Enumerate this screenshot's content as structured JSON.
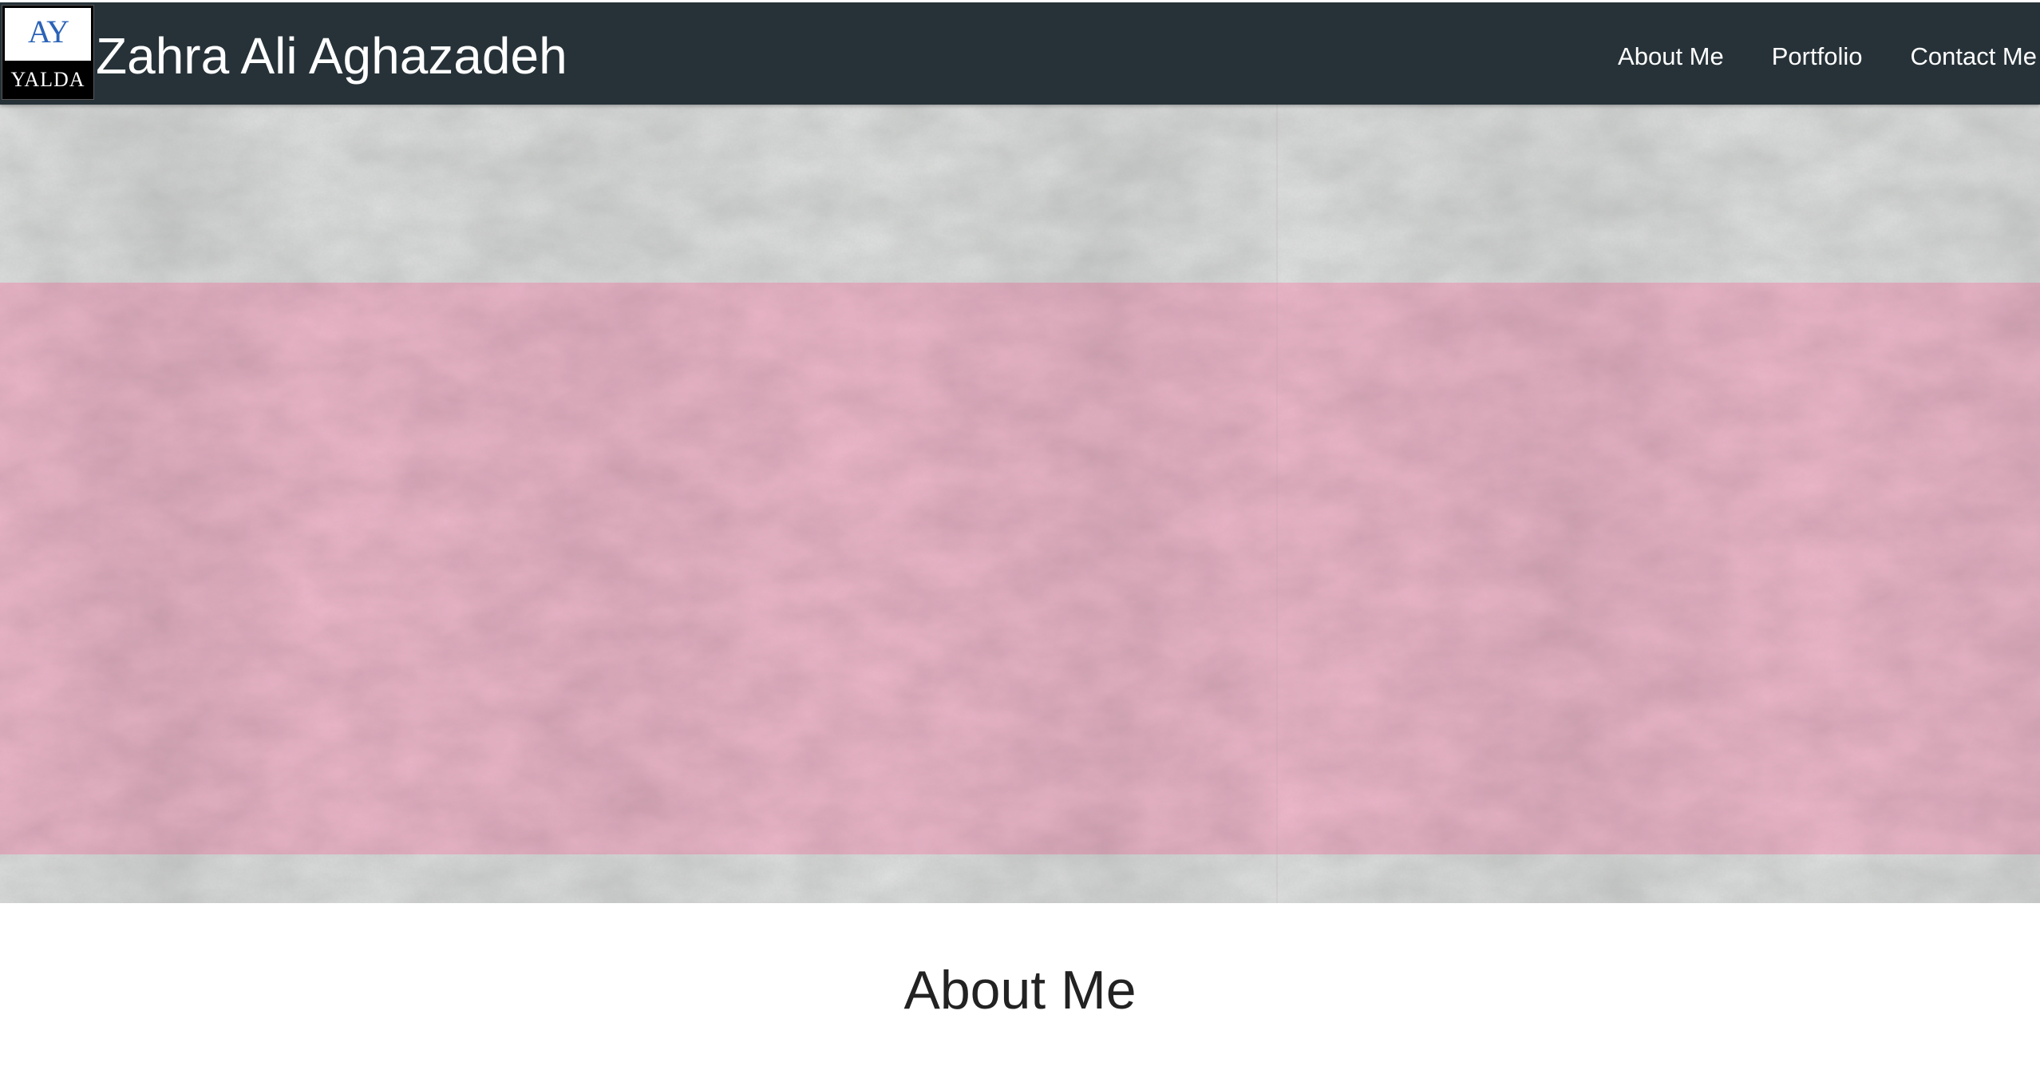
{
  "logo": {
    "monogram": "AY",
    "wordmark": "YALDA"
  },
  "brand": {
    "name": "Zahra Ali Aghazadeh"
  },
  "nav": {
    "items": [
      {
        "label": "About Me"
      },
      {
        "label": "Portfolio"
      },
      {
        "label": "Contact Me"
      }
    ]
  },
  "hero": {
    "background": "plaster-wall-texture",
    "band_color": "#f2b8cc",
    "wall_color": "#e3e5e4"
  },
  "about": {
    "heading": "About Me"
  },
  "colors": {
    "navbar": "#263238",
    "nav_text": "#ffffff",
    "heading_text": "#222222",
    "page_background": "#ffffff"
  }
}
